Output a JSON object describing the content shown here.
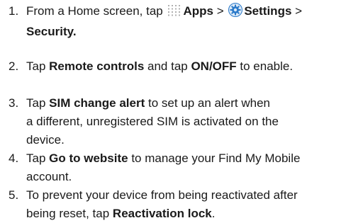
{
  "steps": [
    {
      "number": "1.",
      "parts": {
        "text1": "From a Home screen, tap ",
        "apps": "Apps",
        "sep1": " > ",
        "settings": "Settings",
        "sep2": " >",
        "security": "Security."
      }
    },
    {
      "number": "2.",
      "parts": {
        "text1": "Tap ",
        "bold1": "Remote controls",
        "text2": " and tap ",
        "bold2": "ON/OFF",
        "text3": " to enable."
      }
    },
    {
      "number": "3.",
      "parts": {
        "text1": "Tap ",
        "bold1": "SIM change alert",
        "text2": " to set up an alert when",
        "text3": "a different, unregistered SIM is activated on the",
        "text4": "device."
      }
    },
    {
      "number": "4.",
      "parts": {
        "text1": "Tap ",
        "bold1": "Go to website",
        "text2": " to manage your Find My Mobile",
        "text3": "account."
      }
    },
    {
      "number": "5.",
      "parts": {
        "text1": "To prevent your device from being reactivated after",
        "text2": "being reset, tap ",
        "bold1": "Reactivation lock",
        "text3": "."
      }
    }
  ],
  "icons": {
    "apps": "apps-grid-icon",
    "settings": "settings-gear-icon"
  },
  "colors": {
    "text": "#1a1a1a",
    "apps_icon_dots": "#b0b0b0",
    "settings_icon_blue": "#2a79c9"
  }
}
